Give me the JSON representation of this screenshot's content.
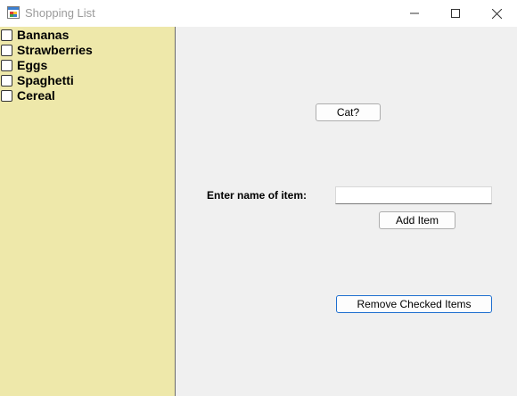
{
  "window": {
    "title": "Shopping List",
    "icon": "form-icon",
    "controls": {
      "minimize": "minimize-icon",
      "maximize": "maximize-icon",
      "close": "close-icon"
    }
  },
  "list": {
    "background_color": "#eee8aa",
    "items": [
      {
        "label": "Bananas",
        "checked": false
      },
      {
        "label": "Strawberries",
        "checked": false
      },
      {
        "label": "Eggs",
        "checked": false
      },
      {
        "label": "Spaghetti",
        "checked": false
      },
      {
        "label": "Cereal",
        "checked": false
      }
    ]
  },
  "buttons": {
    "cat_label": "Cat?",
    "add_item_label": "Add Item",
    "remove_checked_label": "Remove Checked Items"
  },
  "entry": {
    "prompt_label": "Enter name of item:",
    "value": "",
    "placeholder": ""
  },
  "colors": {
    "focus_border": "#1e6fcf"
  }
}
